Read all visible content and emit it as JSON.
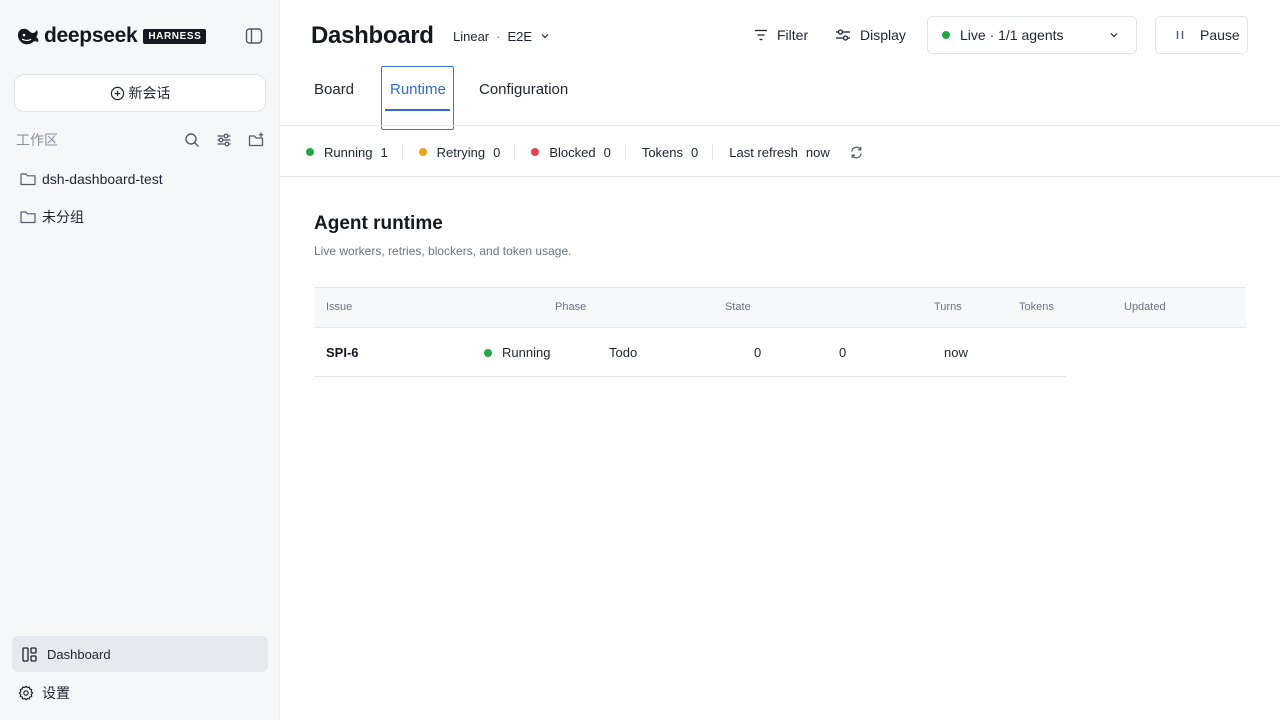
{
  "brand": {
    "name": "deepseek",
    "badge": "HARNESS"
  },
  "sidebar": {
    "new_chat_label": "新会话",
    "workspace_title": "工作区",
    "folders": [
      {
        "label": "dsh-dashboard-test"
      },
      {
        "label": "未分组"
      }
    ],
    "nav": {
      "dashboard_label": "Dashboard",
      "settings_label": "设置"
    }
  },
  "header": {
    "title": "Dashboard",
    "source": {
      "provider": "Linear",
      "separator": "·",
      "project": "E2E"
    },
    "filter_label": "Filter",
    "display_label": "Display",
    "live_status": {
      "label": "Live · 1/1 agents",
      "color": "#22a845"
    },
    "pause_label": "Pause"
  },
  "tabs": [
    {
      "label": "Board",
      "active": false
    },
    {
      "label": "Runtime",
      "active": true
    },
    {
      "label": "Configuration",
      "active": false
    }
  ],
  "stats": {
    "running": {
      "label": "Running",
      "value": "1",
      "color": "#22a845"
    },
    "retrying": {
      "label": "Retrying",
      "value": "0",
      "color": "#f0a416"
    },
    "blocked": {
      "label": "Blocked",
      "value": "0",
      "color": "#e5414b"
    },
    "tokens": {
      "label": "Tokens",
      "value": "0"
    },
    "last_refresh": {
      "label": "Last refresh",
      "value": "now"
    }
  },
  "section": {
    "title": "Agent runtime",
    "subtitle": "Live workers, retries, blockers, and token usage."
  },
  "table": {
    "columns": [
      "Issue",
      "Phase",
      "State",
      "Turns",
      "Tokens",
      "Updated"
    ],
    "rows": [
      {
        "issue": "SPI-6",
        "phase": "Running",
        "phase_color": "#22a845",
        "state": "Todo",
        "turns": "0",
        "tokens": "0",
        "updated": "now"
      }
    ]
  },
  "colors": {
    "accent": "#2f6bd3",
    "sidebar_bg": "#f6f7f9",
    "active_nav_bg": "#e6e9ee"
  }
}
